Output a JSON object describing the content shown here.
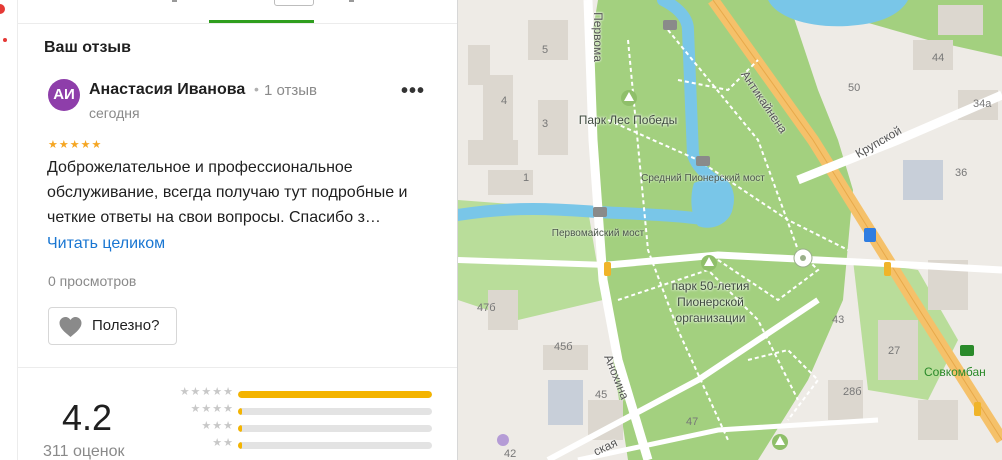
{
  "review_section": {
    "title": "Ваш отзыв",
    "author": {
      "initials": "АИ",
      "name": "Анастасия Иванова",
      "separator": "•",
      "reviews_count": "1 отзыв",
      "date": "сегодня",
      "avatar_color": "#8e3eaa"
    },
    "more_label": "•••",
    "stars_label": "★★★★★",
    "rating_stars": 5,
    "text": "Доброжелательное и профессиональное обслуживание, всегда получаю тут подробные и четкие ответы на свои вопросы. Спасибо з…",
    "read_more": "Читать целиком",
    "views": "0 просмотров",
    "useful_button": "Полезно?"
  },
  "rating_summary": {
    "value": "4.2",
    "count": "311 оценок",
    "distribution": [
      {
        "stars": "★★★★★",
        "fraction": 1.0
      },
      {
        "stars": "★★★★",
        "fraction": 0.02
      },
      {
        "stars": "★★★",
        "fraction": 0.02
      },
      {
        "stars": "★★",
        "fraction": 0.02
      }
    ]
  },
  "map": {
    "labels": {
      "park_les_pobedy": "Парк Лес Победы",
      "sredny_most": "Средний Пионерский мост",
      "pervomaysky_most": "Первомайский мост",
      "park_50": "парк 50-летия Пионерской организации",
      "street_antikaynena": "Антикайнена",
      "street_kupskoy": "Крупской",
      "street_anokhina": "Анохина",
      "street_pervomaysky": "Первома",
      "street_bottom": "ская",
      "bank": "Совкомбан"
    },
    "house_numbers": [
      "5",
      "4",
      "3",
      "1",
      "44",
      "50",
      "34а",
      "36",
      "47б",
      "45б",
      "45",
      "43",
      "27",
      "28б",
      "47",
      "42"
    ]
  },
  "colors": {
    "accent_green": "#2f9e1e",
    "link_blue": "#1976d2",
    "star_gold": "#f5a623",
    "bar_fill": "#f4b400",
    "park_green": "#a3d07f",
    "water": "#79c6e8",
    "road_orange": "#f5c16a"
  }
}
